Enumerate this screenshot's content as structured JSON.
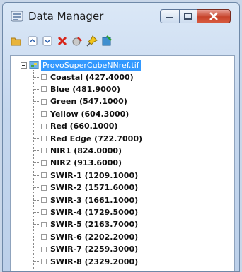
{
  "window": {
    "title": "Data Manager"
  },
  "tree": {
    "root_label": "ProvoSuperCubeNNref.tif",
    "items": [
      "Coastal (427.4000)",
      "Blue (481.9000)",
      "Green (547.1000)",
      "Yellow (604.3000)",
      "Red (660.1000)",
      "Red Edge (722.7000)",
      "NIR1 (824.0000)",
      "NIR2 (913.6000)",
      "SWIR-1 (1209.1000)",
      "SWIR-2 (1571.6000)",
      "SWIR-3 (1661.1000)",
      "SWIR-4 (1729.5000)",
      "SWIR-5 (2163.7000)",
      "SWIR-6 (2202.2000)",
      "SWIR-7 (2259.3000)",
      "SWIR-8 (2329.2000)"
    ]
  },
  "toolbar": {
    "icons": [
      "open-folder-icon",
      "expand-all-icon",
      "collapse-all-icon",
      "delete-icon",
      "remove-icon",
      "pin-icon",
      "load-icon"
    ]
  },
  "colors": {
    "selection": "#3399ff",
    "close_button": "#c6432b"
  }
}
